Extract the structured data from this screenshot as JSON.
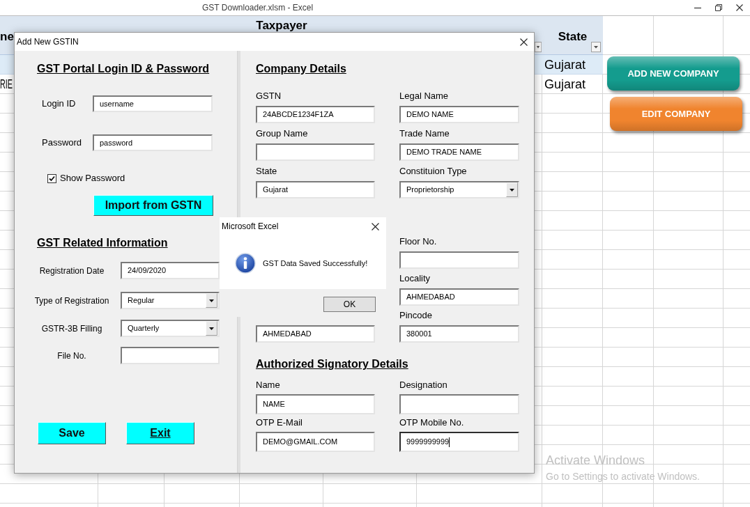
{
  "window": {
    "title": "GST Downloader.xlsm - Excel"
  },
  "sheet": {
    "columns": [
      {
        "label": "ne"
      },
      {
        "label": "Taxpayer"
      },
      {
        "label": "State"
      }
    ],
    "rows": [
      {
        "state": "Gujarat"
      },
      {
        "column_1": "RIE",
        "state": "Gujarat"
      }
    ]
  },
  "sheet_buttons": [
    {
      "label": "ADD NEW COMPANY",
      "color": "#149c8e"
    },
    {
      "label": "EDIT COMPANY",
      "color": "#f0842e"
    }
  ],
  "dialog": {
    "title": "Add New GSTIN",
    "login": {
      "heading": "GST Portal Login ID & Password",
      "fields": [
        {
          "label": "Login ID",
          "value": "username"
        },
        {
          "label": "Password",
          "value": "password"
        }
      ],
      "show_password": {
        "label": "Show Password",
        "checked": true
      },
      "import_button": "Import from GSTN"
    },
    "gst_info": {
      "heading": "GST Related Information",
      "fields": [
        {
          "label": "Registration Date",
          "value": "24/09/2020",
          "kind": "text"
        },
        {
          "label": "Type of Registration",
          "value": "Regular",
          "kind": "select"
        },
        {
          "label": "GSTR-3B Filling",
          "value": "Quarterly",
          "kind": "select"
        },
        {
          "label": "File No.",
          "kind": "text"
        }
      ]
    },
    "buttons": [
      {
        "label": "Save",
        "underlined": false
      },
      {
        "label": "Exit",
        "underlined": true
      }
    ],
    "company_details": {
      "heading": "Company Details",
      "fields": [
        {
          "label": "GSTN",
          "value": "24ABCDE1234F1ZA",
          "kind": "text"
        },
        {
          "label": "Legal Name",
          "value": "DEMO NAME",
          "kind": "text"
        },
        {
          "label": "Group Name",
          "kind": "text"
        },
        {
          "label": "Trade Name",
          "value": "DEMO TRADE NAME",
          "kind": "text"
        },
        {
          "label": "State",
          "value": "Gujarat",
          "kind": "text"
        },
        {
          "label": "Constituion Type",
          "value": "Proprietorship",
          "kind": "select"
        }
      ]
    },
    "company_address": {
      "left_column": [
        {
          "value": "AHMEDABAD"
        }
      ],
      "right_column": [
        {
          "label": "Floor No."
        },
        {
          "label": "Locality",
          "value": "AHMEDABAD"
        },
        {
          "label": "Pincode",
          "value": "380001"
        }
      ]
    },
    "signatory": {
      "heading": "Authorized Signatory Details",
      "fields": [
        {
          "label": "Name",
          "value": "NAME",
          "focused": false
        },
        {
          "label": "Designation",
          "focused": false
        },
        {
          "label": "OTP E-Mail",
          "value": "DEMO@GMAIL.COM",
          "focused": false
        },
        {
          "label": "OTP Mobile No.",
          "value": "9999999999",
          "focused": true
        }
      ]
    }
  },
  "message_box": {
    "title": "Microsoft Excel",
    "message": "GST Data Saved Successfully!",
    "button": "OK"
  },
  "os_notice": {
    "title": "Activate Windows",
    "text": "Go to Settings to activate Windows."
  }
}
